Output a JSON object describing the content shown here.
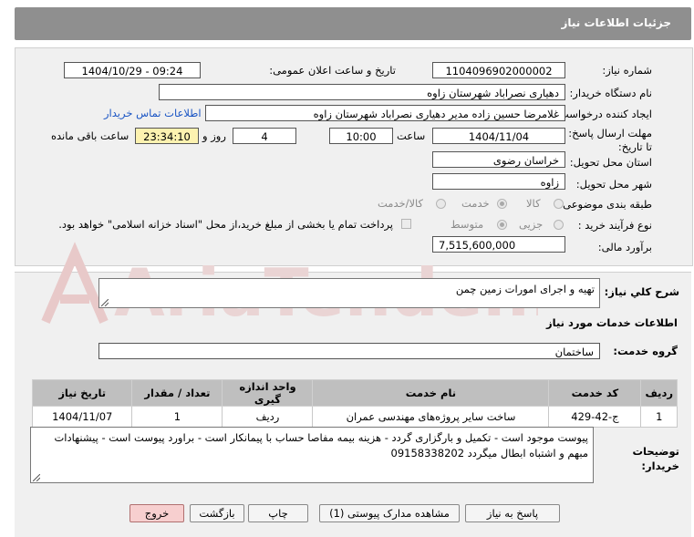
{
  "header": {
    "title": "جزئیات اطلاعات نیاز"
  },
  "form": {
    "need_number": {
      "label": "شماره نیاز:",
      "value": "1104096902000002"
    },
    "announce_datetime": {
      "label": "تاریخ و ساعت اعلان عمومی:",
      "value": "1404/10/29 - 09:24"
    },
    "buyer_org": {
      "label": "نام دستگاه خریدار:",
      "value": "دهیاری نصراباد شهرستان زاوه"
    },
    "requester": {
      "label": "ایجاد کننده درخواست:",
      "value": "غلامرضا حسین زاده مدیر دهیاری نصراباد شهرستان زاوه",
      "contact_link": "اطلاعات تماس خریدار"
    },
    "deadline": {
      "label": "مهلت ارسال پاسخ: تا تاریخ:",
      "date": "1404/11/04",
      "time_label": "ساعت",
      "time": "10:00",
      "days": "4",
      "days_label": "روز و",
      "remaining": "23:34:10",
      "remaining_label": "ساعت باقی مانده"
    },
    "province": {
      "label": "استان محل تحویل:",
      "value": "خراسان رضوی"
    },
    "city": {
      "label": "شهر محل تحویل:",
      "value": "زاوه"
    },
    "category": {
      "label": "طبقه بندی موضوعی:",
      "options": [
        "کالا",
        "خدمت",
        "کالا/خدمت"
      ],
      "selected": "خدمت"
    },
    "purchase_process": {
      "label": "نوع فرآیند خرید :",
      "options": [
        "جزیی",
        "متوسط"
      ],
      "selected": "متوسط",
      "payment_note": "پرداخت تمام یا بخشی از مبلغ خرید،از محل \"اسناد خزانه اسلامی\" خواهد بود."
    },
    "estimate": {
      "label": "برآورد مالی:",
      "value": "7,515,600,000"
    }
  },
  "description": {
    "label": "شرح کلي نياز:",
    "value": "تهیه و اجرای امورات زمین چمن"
  },
  "services": {
    "section_title": "اطلاعات خدمات مورد نياز",
    "group_label": "گروه خدمت:",
    "group_value": "ساختمان",
    "columns": [
      "رديف",
      "کد خدمت",
      "نام خدمت",
      "واحد اندازه گيری",
      "تعداد / مقدار",
      "تاريخ نياز"
    ],
    "rows": [
      [
        "1",
        "ج-42-429",
        "ساخت سایر پروژه‌های مهندسی عمران",
        "ردیف",
        "1",
        "1404/11/07"
      ]
    ]
  },
  "buyer_notes": {
    "label": "توضيحات خريدار:",
    "value": "پیوست موجود است - تکمیل و بارگزاری گردد - هزینه بیمه مفاصا حساب با پیمانکار است - براورد پیوست است - پیشنهادات مبهم و اشتباه ابطال میگردد 09158338202"
  },
  "buttons": {
    "reply": "پاسخ به نياز",
    "attachments": "مشاهده مدارک پيوستی (1)",
    "print": "چاپ",
    "back": "بازگشت",
    "exit": "خروج"
  },
  "watermark": {
    "text": "AriaTender.neT"
  },
  "colors": {
    "header_bg": "#8f8f8f",
    "panel_bg": "#f0f0f0",
    "link": "#1a55c4",
    "remaining_bg": "#fdf2b0",
    "exit_bg": "#f7cfcf",
    "watermark": "#e8c9c9"
  }
}
